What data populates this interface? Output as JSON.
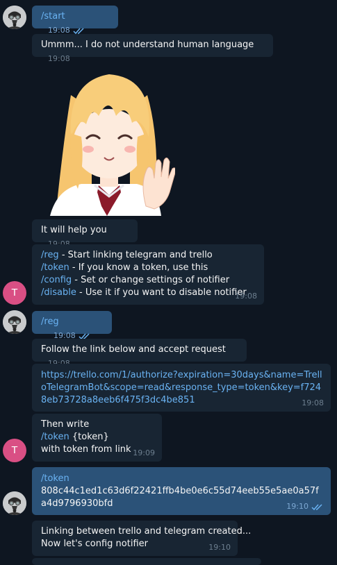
{
  "messages": {
    "m1": {
      "command": "/start",
      "time": "19:08"
    },
    "m2": {
      "text": "Ummm... I do not understand human language",
      "time": "19:08"
    },
    "m3": {
      "text": "It will help you",
      "time": "19:08"
    },
    "m4": {
      "lines": [
        {
          "cmd": "/reg",
          "desc": " - Start linking telegram and trello"
        },
        {
          "cmd": "/token",
          "desc": " - If you know a token, use this"
        },
        {
          "cmd": "/config",
          "desc": " - Set or change settings of notifier"
        },
        {
          "cmd": "/disable",
          "desc": " - Use it if you want to disable notifier"
        }
      ],
      "time": "19:08"
    },
    "m5": {
      "command": "/reg",
      "time": "19:08"
    },
    "m6": {
      "text": "Follow the link below and accept request",
      "time": "19:08"
    },
    "m7": {
      "link": "https://trello.com/1/authorize?expiration=30days&name=TrelloTelegramBot&scope=read&response_type=token&key=f7248eb73728a8eeb6f475f3dc4be851",
      "time": "19:08"
    },
    "m8": {
      "line1": "Then write",
      "cmd": "/token",
      "arg": " {token}",
      "line3": "with token from link",
      "time": "19:09"
    },
    "m9": {
      "cmd": "/token",
      "value": "808c44c1ed1c63d6f22421ffb4be0e6c55d74eeb55e5ae0a57fa4d9796930bfd",
      "time": "19:10"
    },
    "m10": {
      "line1": "Linking between trello and telegram created...",
      "line2": "Now let's config notifier",
      "time": "19:10"
    }
  },
  "avatars": {
    "bot_letter": "T"
  },
  "colors": {
    "background": "#0e1621",
    "incoming": "#182533",
    "outgoing": "#2b5278",
    "link": "#6ab3f3",
    "bot_avatar": "#d94f84"
  }
}
